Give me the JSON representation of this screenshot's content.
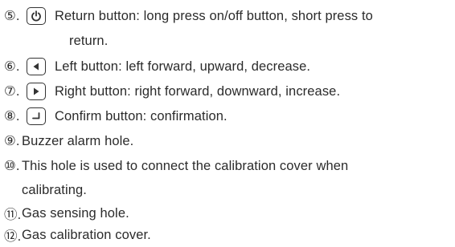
{
  "items": [
    {
      "num": "⑤.",
      "icon": "power-icon",
      "text": "Return button: long press on/off button, short press to",
      "cont": "return."
    },
    {
      "num": "⑥.",
      "icon": "left-arrow-icon",
      "text": "Left button: left forward, upward, decrease."
    },
    {
      "num": "⑦.",
      "icon": "right-arrow-icon",
      "text": "Right button: right forward, downward, increase."
    },
    {
      "num": "⑧.",
      "icon": "enter-icon",
      "text": "Confirm button: confirmation."
    },
    {
      "num": "⑨.",
      "text": "Buzzer alarm hole."
    },
    {
      "num": "⑩.",
      "text": "This hole is used to connect the calibration cover when",
      "cont": "calibrating."
    },
    {
      "num": "⑪.",
      "text": "Gas sensing hole."
    },
    {
      "num": "⑫.",
      "text": "Gas calibration cover."
    }
  ]
}
